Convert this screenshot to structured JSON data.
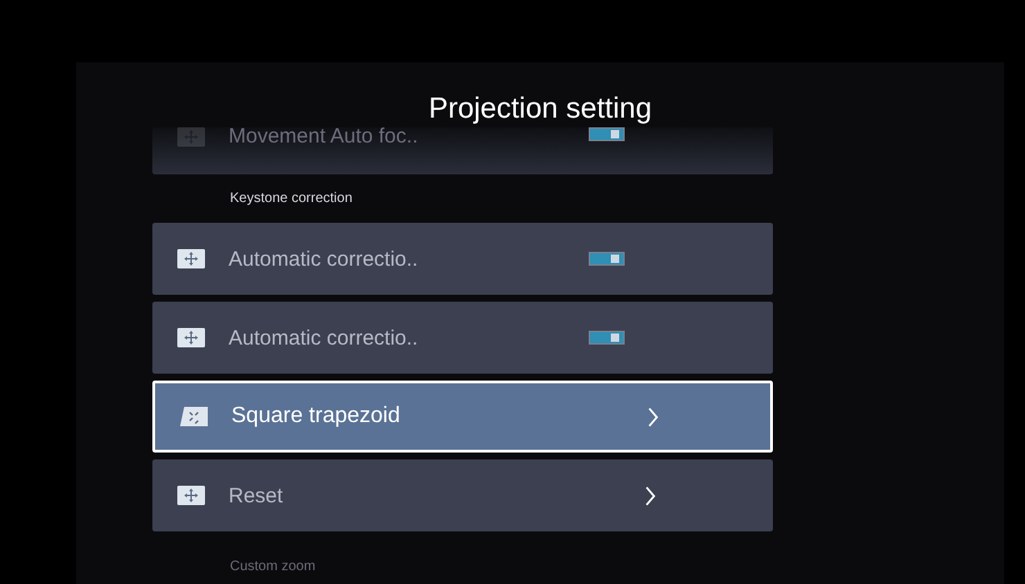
{
  "title": "Projection setting",
  "items": [
    {
      "kind": "toggle",
      "label": "Movement Auto foc..",
      "on": true,
      "selected": false,
      "faded": true
    },
    {
      "kind": "section",
      "label": "Keystone correction",
      "faded": false
    },
    {
      "kind": "toggle",
      "label": "Automatic correctio..",
      "on": true,
      "selected": false,
      "faded": false
    },
    {
      "kind": "toggle",
      "label": "Automatic correctio..",
      "on": true,
      "selected": false,
      "faded": false
    },
    {
      "kind": "link",
      "label": "Square trapezoid",
      "selected": true,
      "faded": false
    },
    {
      "kind": "link",
      "label": "Reset",
      "selected": false,
      "faded": false
    },
    {
      "kind": "section",
      "label": "Custom zoom",
      "faded": true
    }
  ]
}
